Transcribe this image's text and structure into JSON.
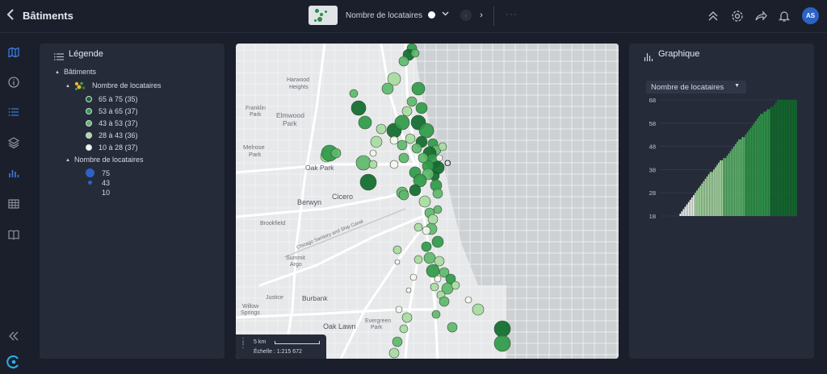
{
  "header": {
    "back_icon": "chevron-left-icon",
    "title": "Bâtiments",
    "layer_name": "Nombre de locataires",
    "next_glyph": "›",
    "prev_glyph": "‹",
    "user_initials": "AS",
    "icons": [
      "chevrons-up-icon",
      "gear-icon",
      "share-icon",
      "bell-icon"
    ]
  },
  "sidebar": {
    "icons": [
      "map-icon",
      "info-icon",
      "list-icon",
      "layers-icon",
      "bar-chart-icon",
      "table-icon",
      "book-icon",
      "collapse-icon",
      "logo-icon"
    ]
  },
  "legend": {
    "title": "Légende",
    "group_label": "Bâtiments",
    "layer_label": "Nombre de locataires",
    "classes": [
      {
        "label": "65 à 75 (35)",
        "color": "#0f6b2a"
      },
      {
        "label": "53 à 65 (37)",
        "color": "#2e9a47"
      },
      {
        "label": "43 à 53 (37)",
        "color": "#5db86a"
      },
      {
        "label": "28 à 43 (36)",
        "color": "#a8dba0"
      },
      {
        "label": "10 à 28 (37)",
        "color": "#f2f8ee"
      }
    ],
    "size_label": "Nombre de locataires",
    "sizes": [
      "75",
      "43",
      "10"
    ]
  },
  "chart": {
    "title": "Graphique",
    "dropdown_value": "Nombre de locataires"
  },
  "map": {
    "scale_distance": "5 km",
    "scale_text": "Échelle : 1:215 672",
    "labels": {
      "harwood": "Harwood",
      "heights": "Heights",
      "franklin": "Franklin",
      "park_franklin": "Park",
      "elmwood": "Elmwood",
      "park_elmwood": "Park",
      "melrose": "Melrose",
      "park_melrose": "Park",
      "oak_park": "Oak Park",
      "berwyn": "Berwyn",
      "cicero": "Cicero",
      "brookfield": "Brookfield",
      "canal": "Chicago Sanitary and Ship Canal",
      "summit": "Summit",
      "argo": "Argo",
      "justice": "Justice",
      "burbank": "Burbank",
      "willow": "Willow",
      "springs": "Springs",
      "oak_lawn": "Oak Lawn",
      "evergreen": "Evergreen",
      "park_evergreen": "Park",
      "chicago_fragment": "O"
    }
  },
  "chart_data": {
    "type": "bar",
    "ylim": [
      18,
      68
    ],
    "yticks": [
      18,
      28,
      38,
      48,
      58,
      68
    ],
    "class_colors": [
      "#f2f8ee",
      "#a8dba0",
      "#5db86a",
      "#2e9a47",
      "#0f6b2a"
    ],
    "values": [
      10,
      12,
      14,
      16,
      18,
      19,
      20,
      21,
      22,
      23,
      24,
      25,
      26,
      27,
      28,
      29,
      30,
      31,
      32,
      33,
      34,
      35,
      36,
      37,
      37,
      38,
      39,
      40,
      41,
      42,
      42,
      43,
      43,
      44,
      45,
      46,
      47,
      48,
      49,
      50,
      51,
      51,
      52,
      52,
      53,
      54,
      55,
      56,
      57,
      58,
      59,
      60,
      61,
      62,
      62,
      63,
      63,
      64,
      64,
      65,
      65,
      66,
      67,
      68,
      68,
      68,
      68,
      68,
      68,
      68,
      68,
      68,
      68,
      68,
      68
    ]
  }
}
